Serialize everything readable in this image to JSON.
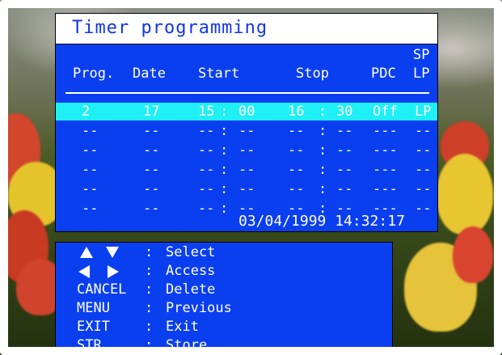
{
  "title": "Timer programming",
  "headers": {
    "prog": "Prog.",
    "date": "Date",
    "start": "Start",
    "stop": "Stop",
    "pdc": "PDC",
    "sp": "SP",
    "lp": "LP"
  },
  "rows": [
    {
      "prog": "2",
      "date": "17",
      "start_h": "15",
      "start_sep": ":",
      "start_m": "00",
      "stop_h": "16",
      "stop_sep": ":",
      "stop_m": "30",
      "pdc": "Off",
      "splp": "LP"
    },
    {
      "prog": "--",
      "date": "--",
      "start_h": "--",
      "start_sep": ":",
      "start_m": "--",
      "stop_h": "--",
      "stop_sep": ":",
      "stop_m": "--",
      "pdc": "---",
      "splp": "--"
    },
    {
      "prog": "--",
      "date": "--",
      "start_h": "--",
      "start_sep": ":",
      "start_m": "--",
      "stop_h": "--",
      "stop_sep": ":",
      "stop_m": "--",
      "pdc": "---",
      "splp": "--"
    },
    {
      "prog": "--",
      "date": "--",
      "start_h": "--",
      "start_sep": ":",
      "start_m": "--",
      "stop_h": "--",
      "stop_sep": ":",
      "stop_m": "--",
      "pdc": "---",
      "splp": "--"
    },
    {
      "prog": "--",
      "date": "--",
      "start_h": "--",
      "start_sep": ":",
      "start_m": "--",
      "stop_h": "--",
      "stop_sep": ":",
      "stop_m": "--",
      "pdc": "---",
      "splp": "--"
    },
    {
      "prog": "--",
      "date": "--",
      "start_h": "--",
      "start_sep": ":",
      "start_m": "--",
      "stop_h": "--",
      "stop_sep": ":",
      "stop_m": "--",
      "pdc": "---",
      "splp": "--"
    }
  ],
  "datetime": "03/04/1999 14:32:17",
  "help": [
    {
      "key_icons": [
        "up-arrow-icon",
        "down-arrow-icon"
      ],
      "colon": ":",
      "desc": "Select"
    },
    {
      "key_icons": [
        "left-arrow-icon",
        "right-arrow-icon"
      ],
      "colon": ":",
      "desc": "Access"
    },
    {
      "key": "CANCEL",
      "colon": ":",
      "desc": "Delete"
    },
    {
      "key": "MENU",
      "colon": ":",
      "desc": "Previous"
    },
    {
      "key": "EXIT",
      "colon": ":",
      "desc": "Exit"
    },
    {
      "key": "STR",
      "colon": ":",
      "desc": "Store"
    }
  ],
  "colors": {
    "panel": "#0a3ff0",
    "highlight": "#1ff0f5",
    "title_text": "#1234e8",
    "text": "#ffffff"
  }
}
